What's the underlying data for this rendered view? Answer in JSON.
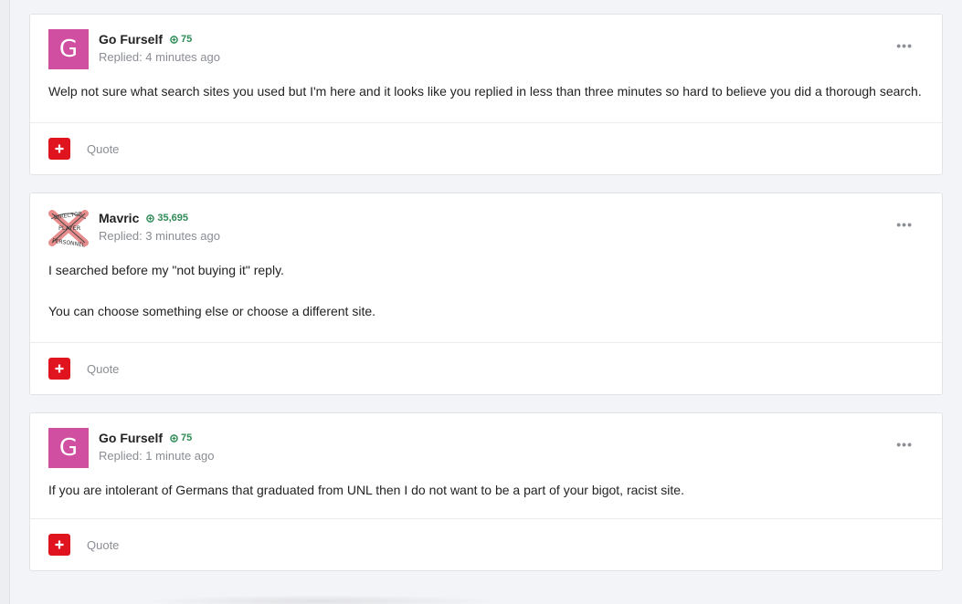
{
  "colors": {
    "reaction_red": "#e0141e",
    "reputation_green": "#2e8b57",
    "avatar_pink": "#d04fa0"
  },
  "posts": [
    {
      "avatar_letter": "G",
      "author": "Go Furself",
      "reputation": "75",
      "date": "Replied: 4 minutes ago",
      "more": "•••",
      "body": [
        "Welp not sure what search sites you used but I'm here and it looks like you replied in less than three minutes so hard to believe you did a thorough search."
      ],
      "quote": "Quote"
    },
    {
      "avatar_image": "director-player-personnel-badge",
      "author": "Mavric",
      "reputation": "35,695",
      "date": "Replied: 3 minutes ago",
      "more": "•••",
      "body": [
        "I searched before my \"not buying it\" reply.",
        "You can choose something else or choose a different site."
      ],
      "quote": "Quote"
    },
    {
      "avatar_letter": "G",
      "author": "Go Furself",
      "reputation": "75",
      "date": "Replied: 1 minute ago",
      "more": "•••",
      "body": [
        "If you are intolerant of Germans that graduated from UNL then I do not want to be a part of your bigot, racist site."
      ],
      "quote": "Quote"
    }
  ]
}
